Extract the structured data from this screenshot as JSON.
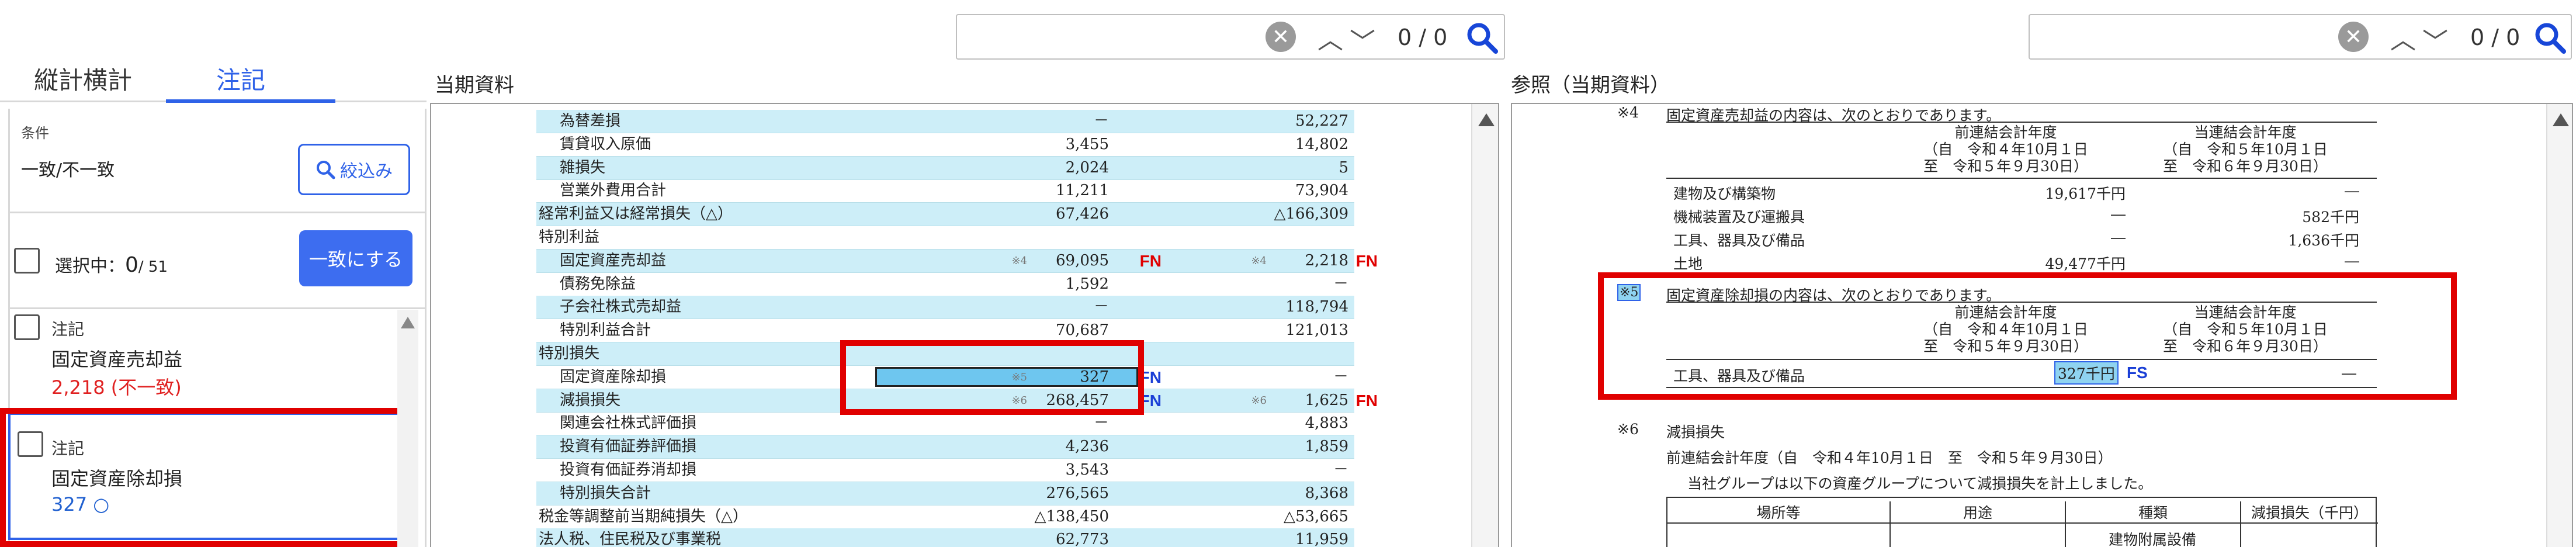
{
  "search_left": {
    "count": "0 / 0"
  },
  "search_right": {
    "count": "0 / 0"
  },
  "tabs": [
    {
      "label": "縦計横計"
    },
    {
      "label": "注記"
    }
  ],
  "condition": {
    "label": "条件",
    "value": "一致/不一致",
    "filter_button": "絞込み"
  },
  "selection": {
    "label": "選択中：",
    "count": "0",
    "total": "/ 51",
    "match_button": "一致にする"
  },
  "note_items": [
    {
      "type": "注記",
      "title": "固定資産売却益",
      "value": "2,218 (不一致)",
      "status_color": "#e02020"
    },
    {
      "type": "注記",
      "title": "固定資産除却損",
      "value": "327",
      "mark": "○",
      "status_color": "#2060d0"
    }
  ],
  "current_doc": {
    "title": "当期資料",
    "rows": [
      {
        "label": "為替差損",
        "v1": "－",
        "v2": "52,227",
        "indent": 1
      },
      {
        "label": "賃貸収入原価",
        "v1": "3,455",
        "v2": "14,802",
        "indent": 1
      },
      {
        "label": "雑損失",
        "v1": "2,024",
        "v2": "5",
        "indent": 1
      },
      {
        "label": "営業外費用合計",
        "v1": "11,211",
        "v2": "73,904",
        "indent": 1
      },
      {
        "label": "経常利益又は経常損失（△）",
        "v1": "67,426",
        "v2": "△166,309",
        "indent": 0
      },
      {
        "label": "特別利益",
        "v1": "",
        "v2": "",
        "indent": 0
      },
      {
        "label": "固定資産売却益",
        "v1": "69,095",
        "v2": "2,218",
        "indent": 1,
        "v1_sup": "※4",
        "v2_sup": "※4",
        "v1_fn": "FN",
        "v2_fn": "FN"
      },
      {
        "label": "債務免除益",
        "v1": "1,592",
        "v2": "－",
        "indent": 1
      },
      {
        "label": "子会社株式売却益",
        "v1": "－",
        "v2": "118,794",
        "indent": 1
      },
      {
        "label": "特別利益合計",
        "v1": "70,687",
        "v2": "121,013",
        "indent": 1
      },
      {
        "label": "特別損失",
        "v1": "",
        "v2": "",
        "indent": 0
      },
      {
        "label": "固定資産除却損",
        "v1": "327",
        "v2": "－",
        "indent": 1,
        "v1_sup": "※5",
        "v1_fn": "FN"
      },
      {
        "label": "減損損失",
        "v1": "268,457",
        "v2": "1,625",
        "indent": 1,
        "v1_sup": "※6",
        "v2_sup": "※6",
        "v1_fn": "FN",
        "v2_fn": "FN"
      },
      {
        "label": "関連会社株式評価損",
        "v1": "－",
        "v2": "4,883",
        "indent": 1
      },
      {
        "label": "投資有価証券評価損",
        "v1": "4,236",
        "v2": "1,859",
        "indent": 1
      },
      {
        "label": "投資有価証券消却損",
        "v1": "3,543",
        "v2": "－",
        "indent": 1
      },
      {
        "label": "特別損失合計",
        "v1": "276,565",
        "v2": "8,368",
        "indent": 1
      },
      {
        "label": "税金等調整前当期純損失（△）",
        "v1": "△138,450",
        "v2": "△53,665",
        "indent": 0
      },
      {
        "label": "法人税、住民税及び事業税",
        "v1": "62,773",
        "v2": "11,959",
        "indent": 0
      }
    ]
  },
  "reference_doc": {
    "title": "参照（当期資料）",
    "note4": {
      "mark": "※4",
      "heading": "固定資産売却益の内容は、次のとおりであります。",
      "col1": [
        "前連結会計年度",
        "（自　令和４年10月１日",
        "至　令和５年９月30日）"
      ],
      "col2": [
        "当連結会計年度",
        "（自　令和５年10月１日",
        "至　令和６年９月30日）"
      ],
      "rows": [
        {
          "label": "建物及び構築物",
          "v1": "19,617千円",
          "v2": "―"
        },
        {
          "label": "機械装置及び運搬具",
          "v1": "―",
          "v2": "582千円"
        },
        {
          "label": "工具、器具及び備品",
          "v1": "―",
          "v2": "1,636千円"
        },
        {
          "label": "土地",
          "v1": "49,477千円",
          "v2": "―"
        }
      ]
    },
    "note5": {
      "mark": "※5",
      "heading": "固定資産除却損の内容は、次のとおりであります。",
      "col1": [
        "前連結会計年度",
        "（自　令和４年10月１日",
        "至　令和５年９月30日）"
      ],
      "col2": [
        "当連結会計年度",
        "（自　令和５年10月１日",
        "至　令和６年９月30日）"
      ],
      "rows": [
        {
          "label": "工具、器具及び備品",
          "v1": "327千円",
          "v2": "―",
          "fs": "FS"
        }
      ]
    },
    "note6": {
      "mark": "※6",
      "heading": "減損損失",
      "period": "前連結会計年度（自　令和４年10月１日　至　令和５年９月30日）",
      "text": "当社グループは以下の資産グループについて減損損失を計上しました。",
      "headers": [
        "場所等",
        "用途",
        "種類",
        "減損損失（千円）"
      ],
      "first_cell": "建物附属設備"
    }
  },
  "colors": {
    "accent": "#2f62e8",
    "highlight": "#cdeef8",
    "red": "#e00000",
    "fn_red": "#e00000",
    "fn_blue": "#1a3fd6"
  }
}
